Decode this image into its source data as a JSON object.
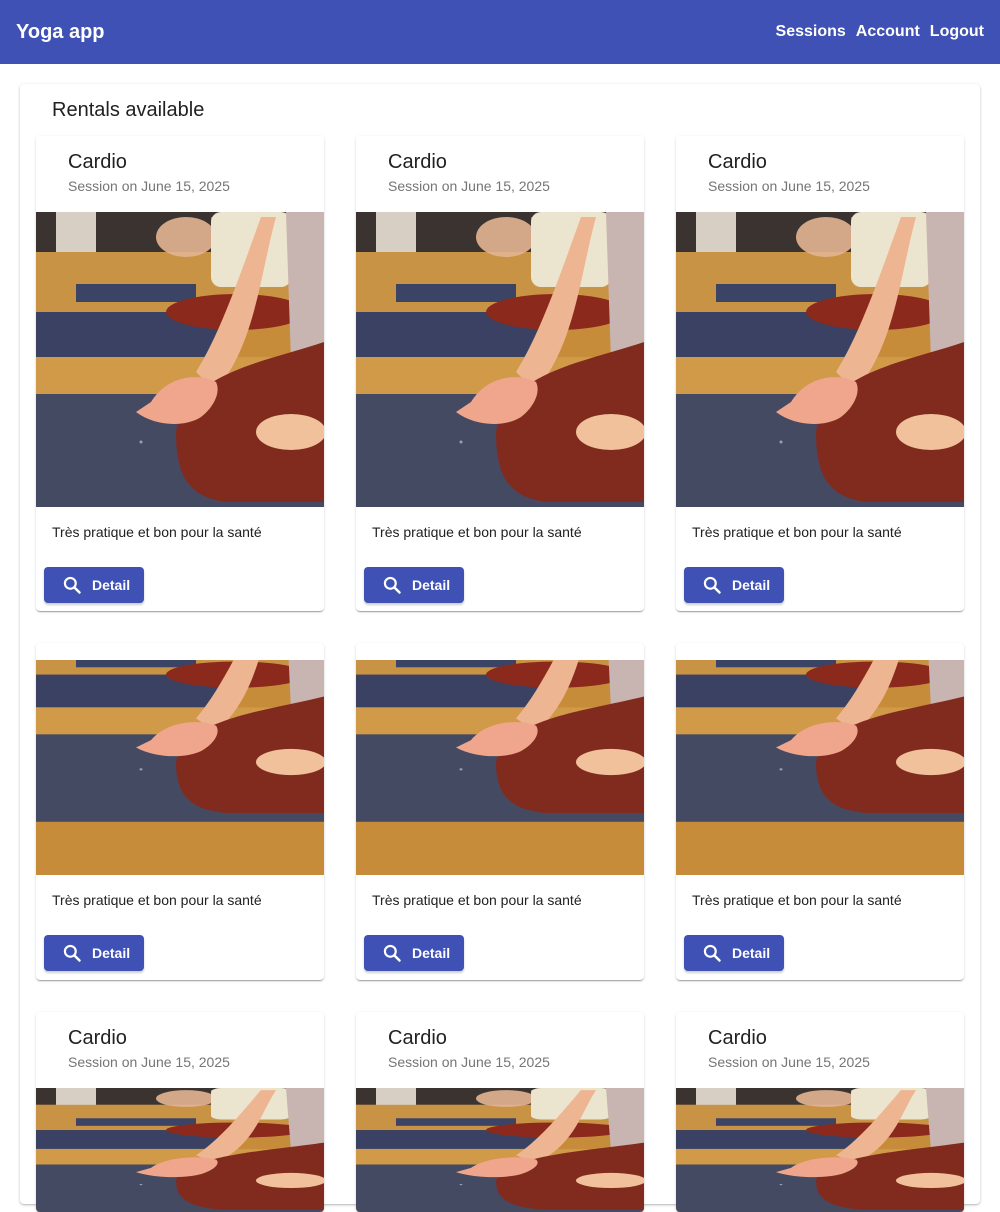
{
  "app": {
    "title": "Yoga app",
    "nav": [
      "Sessions",
      "Account",
      "Logout"
    ],
    "accent_color": "#3f51b5"
  },
  "main": {
    "title": "Rentals available"
  },
  "cards": [
    {
      "title": "Cardio",
      "subtitle": "Session on June 15, 2025",
      "description": "Très pratique et bon pour la santé",
      "button_label": "Detail",
      "button_icon": "search-icon"
    },
    {
      "title": "Cardio",
      "subtitle": "Session on June 15, 2025",
      "description": "Très pratique et bon pour la santé",
      "button_label": "Detail",
      "button_icon": "search-icon"
    },
    {
      "title": "Cardio",
      "subtitle": "Session on June 15, 2025",
      "description": "Très pratique et bon pour la santé",
      "button_label": "Detail",
      "button_icon": "search-icon"
    },
    {
      "title": "",
      "subtitle": "",
      "description": "Très pratique et bon pour la santé",
      "button_label": "Detail",
      "button_icon": "search-icon"
    },
    {
      "title": "",
      "subtitle": "",
      "description": "Très pratique et bon pour la santé",
      "button_label": "Detail",
      "button_icon": "search-icon"
    },
    {
      "title": "",
      "subtitle": "",
      "description": "Très pratique et bon pour la santé",
      "button_label": "Detail",
      "button_icon": "search-icon"
    },
    {
      "title": "Cardio",
      "subtitle": "Session on June 15, 2025",
      "description": "",
      "button_label": "",
      "button_icon": ""
    },
    {
      "title": "Cardio",
      "subtitle": "Session on June 15, 2025",
      "description": "",
      "button_label": "",
      "button_icon": ""
    },
    {
      "title": "Cardio",
      "subtitle": "Session on June 15, 2025",
      "description": "",
      "button_label": "",
      "button_icon": ""
    }
  ]
}
